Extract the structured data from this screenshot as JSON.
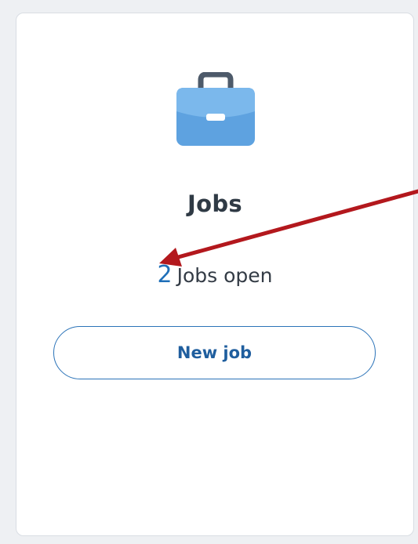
{
  "card": {
    "title": "Jobs",
    "jobs_open_count": "2",
    "jobs_open_label": "Jobs open",
    "new_job_button": "New job"
  },
  "icons": {
    "main": "briefcase-icon"
  },
  "colors": {
    "accent": "#1f6fb8",
    "button_border": "#2b73b8",
    "annotation_arrow": "#b3181d",
    "briefcase_light": "#6fb0e8",
    "briefcase_dark": "#4a8fd0",
    "handle": "#4d5a6a"
  }
}
